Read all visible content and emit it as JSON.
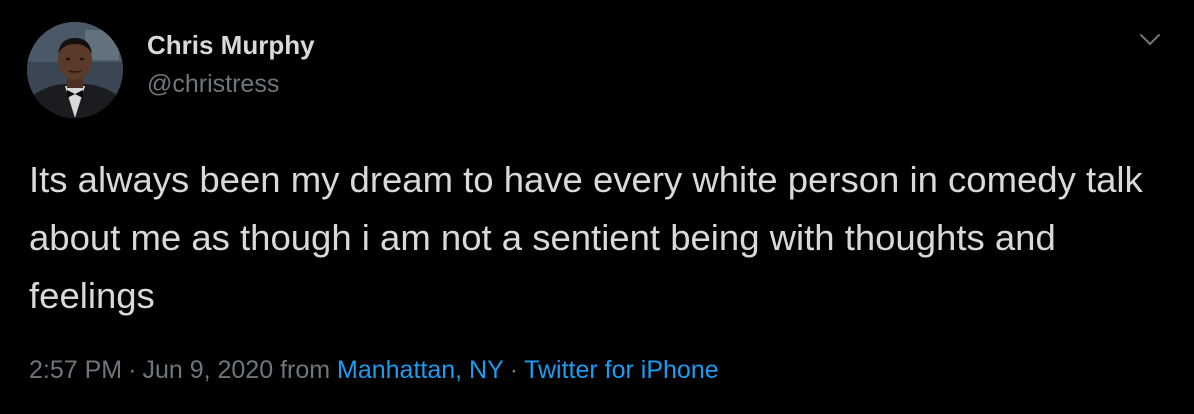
{
  "tweet": {
    "author_name": "Chris Murphy",
    "author_handle": "@christress",
    "text": "Its always been my dream to have every white person in comedy talk about me as though i am not a sentient being with thoughts and feelings",
    "time": "2:57 PM",
    "separator": "·",
    "date": "Jun 9, 2020",
    "from_label": "from",
    "location": "Manhattan, NY",
    "source": "Twitter for iPhone",
    "menu_icon": "chevron-down-icon",
    "link_color": "#1d9bf0",
    "meta_color": "#6e767d",
    "text_color": "#d9d9d9"
  }
}
